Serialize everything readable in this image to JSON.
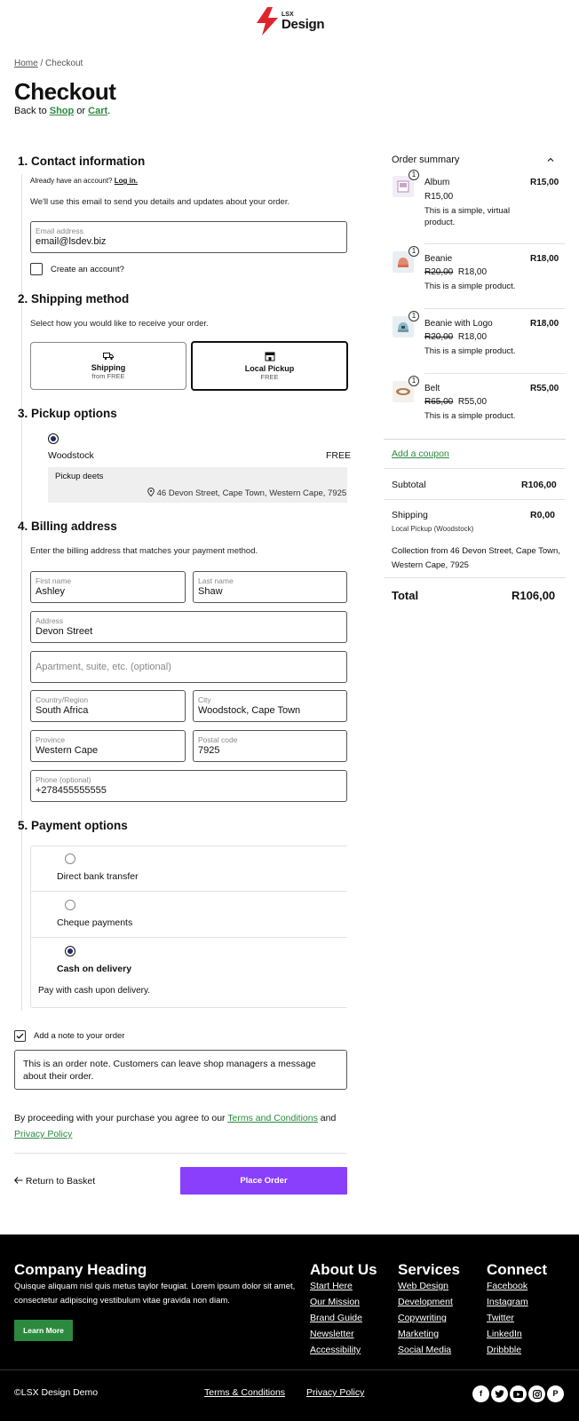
{
  "header": {
    "logo_small": "LSX",
    "logo_big": "Design"
  },
  "breadcrumb": {
    "home": "Home",
    "separator": " / ",
    "current": "Checkout"
  },
  "page": {
    "title": "Checkout",
    "back_prefix": "Back to ",
    "shop": "Shop",
    "or": " or ",
    "cart": "Cart",
    "period": "."
  },
  "contact": {
    "title": "1.  Contact information",
    "have_account": "Already have an account? ",
    "login": "Log in.",
    "note": "We'll use this email to send you details and updates about your order.",
    "email_label": "Email address",
    "email_value": "email@lsdev.biz",
    "create_account": "Create an account?"
  },
  "shipping": {
    "title": "2.  Shipping method",
    "note": "Select how you would like to receive your order.",
    "opt1_title": "Shipping",
    "opt1_sub": "from FREE",
    "opt2_title": "Local Pickup",
    "opt2_sub": "FREE"
  },
  "pickup": {
    "title": "3.  Pickup options",
    "location": "Woodstock",
    "price": "FREE",
    "deets": "Pickup deets",
    "address": "46 Devon Street, Cape Town, Western Cape, 7925"
  },
  "billing": {
    "title": "4.  Billing address",
    "note": "Enter the billing address that matches your payment method.",
    "first_label": "First name",
    "first_value": "Ashley",
    "last_label": "Last name",
    "last_value": "Shaw",
    "address_label": "Address",
    "address_value": "Devon Street",
    "apt_placeholder": "Apartment, suite, etc. (optional)",
    "country_label": "Country/Region",
    "country_value": "South Africa",
    "city_label": "City",
    "city_value": "Woodstock, Cape Town",
    "province_label": "Province",
    "province_value": "Western Cape",
    "postal_label": "Postal code",
    "postal_value": "7925",
    "phone_label": "Phone (optional)",
    "phone_value": "+278455555555"
  },
  "payment": {
    "title": "5.  Payment options",
    "opt1": "Direct bank transfer",
    "opt2": "Cheque payments",
    "opt3": "Cash on delivery",
    "opt3_desc": "Pay with cash upon delivery."
  },
  "order_note": {
    "checkbox_label": "Add a note to your order",
    "text": "This is an order note. Customers can leave shop managers a message about their order."
  },
  "terms": {
    "prefix": "By proceeding with your purchase you agree to our ",
    "terms_link": "Terms and Conditions",
    "and": " and",
    "privacy_link": "Privacy Policy"
  },
  "actions": {
    "return": "Return to Basket",
    "place_order": "Place Order"
  },
  "summary": {
    "title": "Order summary",
    "items": [
      {
        "qty": "1",
        "name": "Album",
        "price": "R15,00",
        "unit": "R15,00",
        "desc": "This is a simple, virtual product."
      },
      {
        "qty": "1",
        "name": "Beanie",
        "price": "R18,00",
        "old": "R20,00",
        "unit": "R18,00",
        "desc": "This is a simple product."
      },
      {
        "qty": "1",
        "name": "Beanie with Logo",
        "price": "R18,00",
        "old": "R20,00",
        "unit": "R18,00",
        "desc": "This is a simple product."
      },
      {
        "qty": "1",
        "name": "Belt",
        "price": "R55,00",
        "old": "R65,00",
        "unit": "R55,00",
        "desc": "This is a simple product."
      }
    ],
    "coupon": "Add a coupon",
    "subtotal_label": "Subtotal",
    "subtotal_value": "R106,00",
    "shipping_label": "Shipping",
    "shipping_value": "R0,00",
    "shipping_method": "Local Pickup (Woodstock)",
    "collection": "Collection from 46 Devon Street, Cape Town, Western Cape, 7925",
    "total_label": "Total",
    "total_value": "R106,00"
  },
  "footer": {
    "company_heading": "Company Heading",
    "company_text": "Quisque aliquam nisl quis metus taylor feugiat. Lorem ipsum dolor sit amet, consectetur adipiscing vestibulum vitae gravida non diam.",
    "learn_more": "Learn More",
    "about_title": "About Us",
    "about_links": [
      "Start Here",
      "Our Mission",
      "Brand Guide",
      "Newsletter",
      "Accessibility"
    ],
    "services_title": "Services",
    "services_links": [
      "Web Design",
      "Development",
      "Copywriting",
      "Marketing",
      "Social Media"
    ],
    "connect_title": "Connect",
    "connect_links": [
      "Facebook",
      "Instagram",
      "Twitter",
      "LinkedIn",
      "Dribbble"
    ],
    "copyright": "©LSX Design Demo",
    "terms": "Terms & Conditions",
    "privacy": "Privacy Policy"
  },
  "colors": {
    "accent": "#8a3ffc",
    "green": "#2b8a3e",
    "logo_red": "#e0242c",
    "footer_bg": "#000000"
  },
  "icons": [
    "bolt-logo-icon",
    "truck-icon",
    "store-icon",
    "location-pin-icon",
    "chevron-up-icon",
    "check-icon",
    "arrow-left-icon",
    "facebook-icon",
    "twitter-icon",
    "youtube-icon",
    "instagram-icon",
    "pinterest-icon"
  ]
}
